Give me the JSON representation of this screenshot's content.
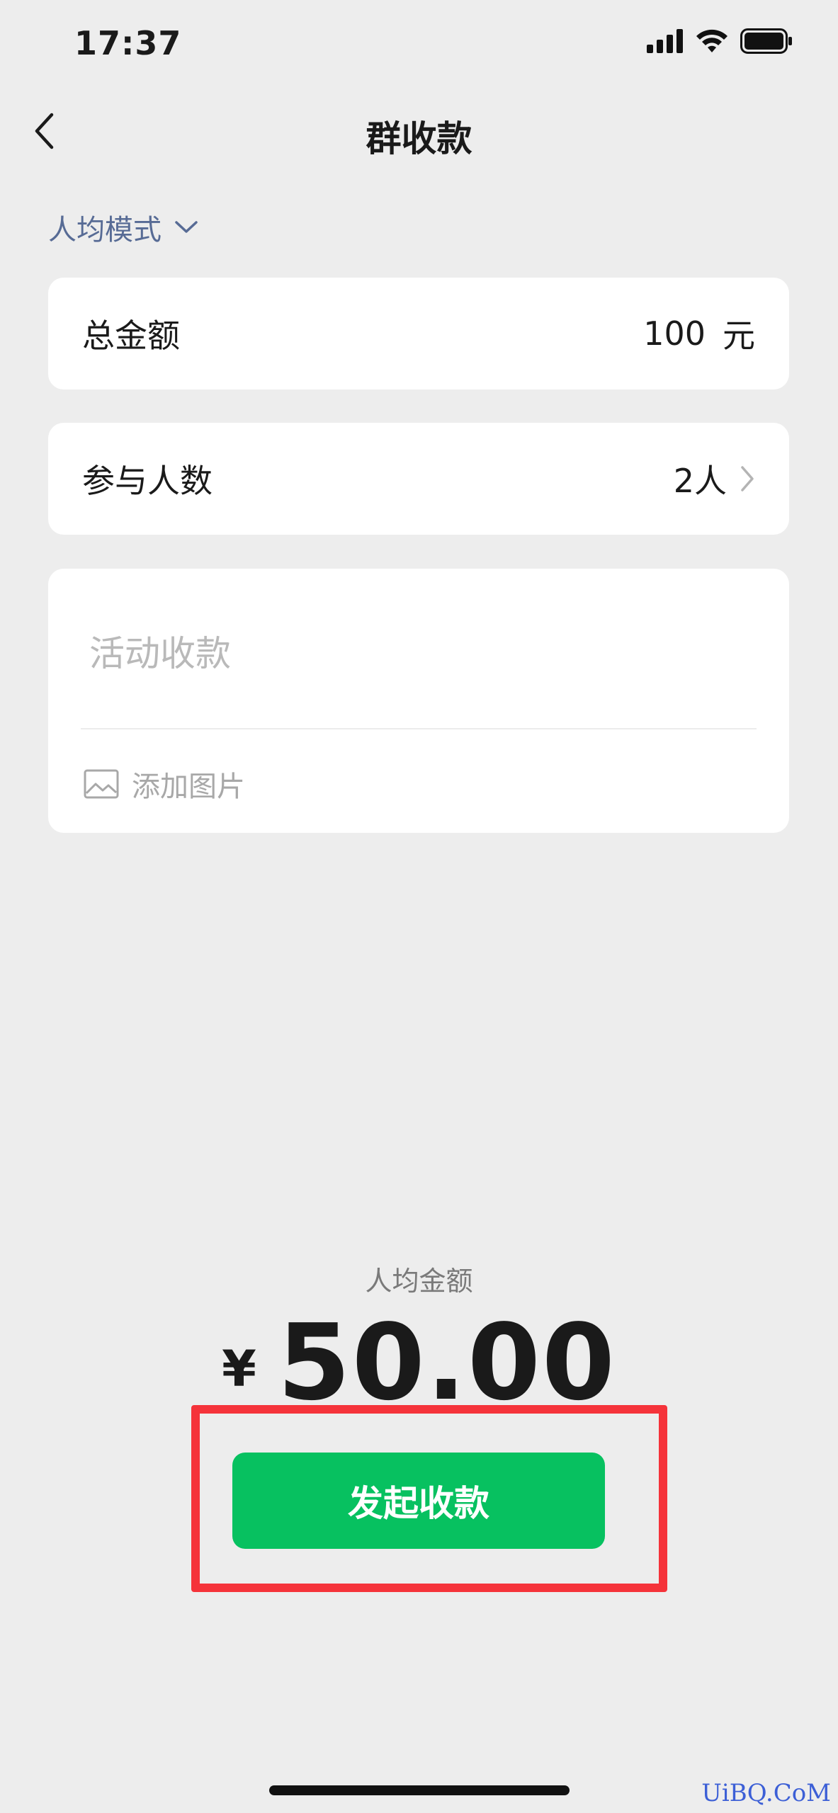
{
  "status_bar": {
    "time": "17:37",
    "icons": [
      "signal-icon",
      "wifi-icon",
      "battery-icon"
    ]
  },
  "nav": {
    "title": "群收款",
    "back_icon": "chevron-left-icon"
  },
  "mode": {
    "label": "人均模式",
    "icon": "chevron-down-icon",
    "color": "#576b95"
  },
  "total_amount": {
    "label": "总金额",
    "value": "100",
    "unit": "元"
  },
  "participants": {
    "label": "参与人数",
    "value": "2人",
    "icon": "chevron-right-icon"
  },
  "note": {
    "placeholder": "活动收款",
    "add_image_label": "添加图片",
    "add_image_icon": "image-icon"
  },
  "per_person": {
    "label": "人均金额",
    "currency": "¥",
    "amount": "50.00"
  },
  "submit_button": {
    "label": "发起收款",
    "color": "#07c160"
  },
  "highlight_color": "#f5333a",
  "watermark": "UiBQ.CoM"
}
